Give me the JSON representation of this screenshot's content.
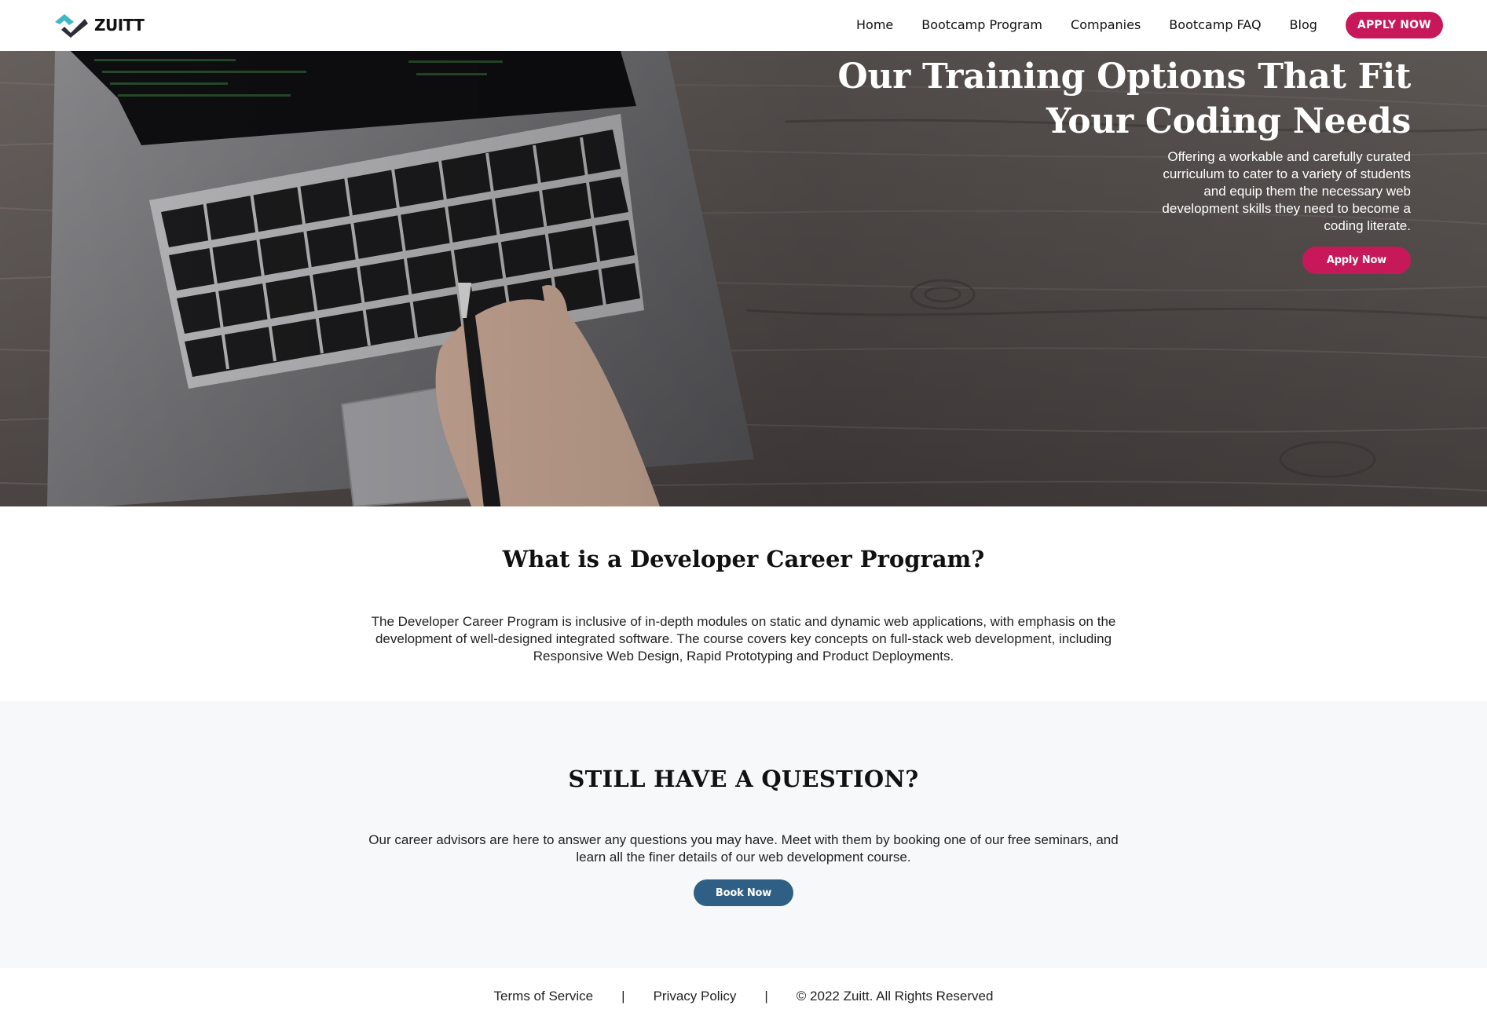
{
  "brand": {
    "name": "ZUITT"
  },
  "nav": {
    "items": [
      {
        "label": "Home"
      },
      {
        "label": "Bootcamp Program"
      },
      {
        "label": "Companies"
      },
      {
        "label": "Bootcamp FAQ"
      },
      {
        "label": "Blog"
      }
    ],
    "cta": "APPLY NOW"
  },
  "hero": {
    "title_line1": "Our Training Options That Fit",
    "title_line2": "Your Coding Needs",
    "text": "Offering a workable and carefully curated curriculum to cater to a variety of students and equip them the necessary web development skills they need to become a coding literate.",
    "cta": "Apply Now"
  },
  "program": {
    "title": "What is a Developer Career Program?",
    "text": "The Developer Career Program is inclusive of in-depth modules on static and dynamic web applications, with emphasis on the development of well-designed integrated software. The course covers key concepts on full-stack web development, including Responsive Web Design, Rapid Prototyping and Product Deployments."
  },
  "question": {
    "title": "STILL HAVE A QUESTION?",
    "text": "Our career advisors are here to answer any questions you may have. Meet with them by booking one of our free seminars, and learn all the finer details of our web development course.",
    "cta": "Book Now"
  },
  "footer": {
    "terms": "Terms of Service",
    "separator": "|",
    "privacy": "Privacy Policy",
    "copyright": "© 2022 Zuitt. All Rights Reserved"
  },
  "colors": {
    "accent": "#c7195a",
    "button_blue": "#2f5f84",
    "light_section": "#f6f8f9",
    "logo_teal": "#3fb8c4"
  }
}
